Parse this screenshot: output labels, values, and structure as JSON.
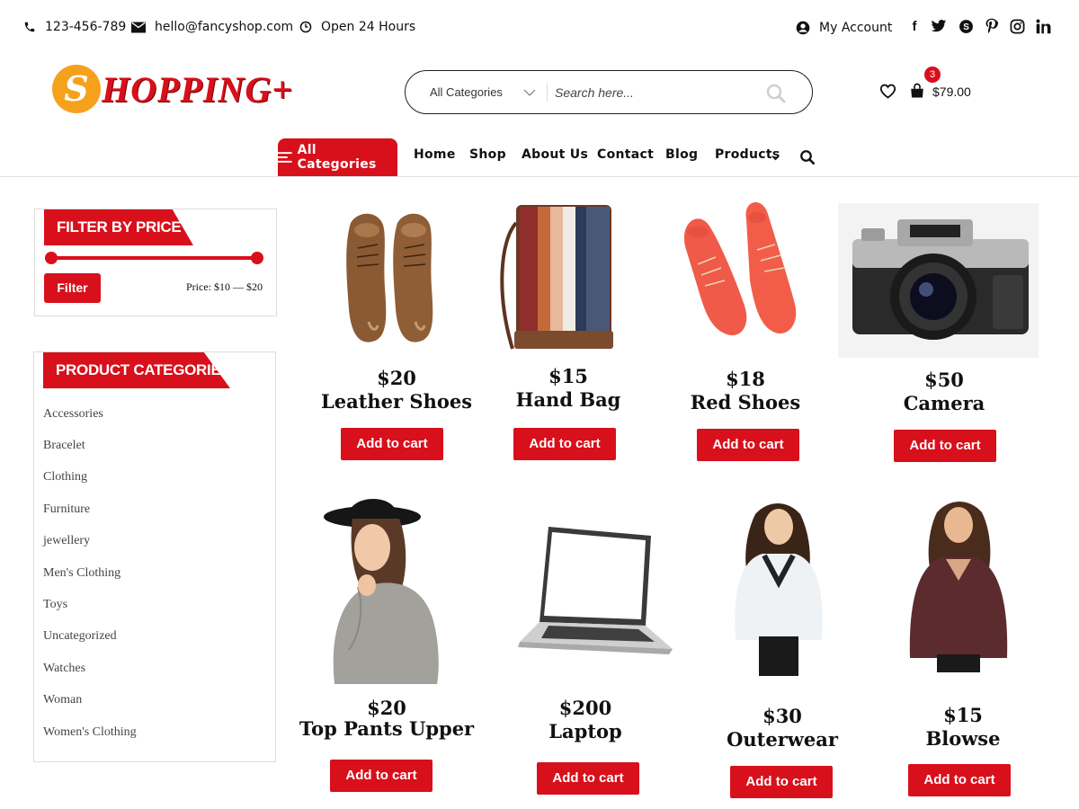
{
  "topbar": {
    "phone": "123-456-789",
    "email": "hello@fancyshop.com",
    "hours": "Open 24 Hours",
    "account": "My Account",
    "social": [
      "facebook-icon",
      "twitter-icon",
      "skype-icon",
      "pinterest-icon",
      "instagram-icon",
      "linkedin-icon"
    ]
  },
  "logo": {
    "initial": "S",
    "text": "HOPPING+"
  },
  "search": {
    "category": "All Categories",
    "placeholder": "Search here..."
  },
  "header": {
    "cart_count": "3",
    "cart_total": "$79.00"
  },
  "nav": {
    "all_categories": "All Categories",
    "items": [
      "Home",
      "Shop",
      "About Us",
      "Contact",
      "Blog",
      "Products"
    ]
  },
  "filter": {
    "title": "FILTER BY PRICE",
    "button": "Filter",
    "range": "Price: $10 — $20"
  },
  "categories": {
    "title": "PRODUCT CATEGORIES",
    "items": [
      "Accessories",
      "Bracelet",
      "Clothing",
      "Furniture",
      "jewellery",
      "Men's Clothing",
      "Toys",
      "Uncategorized",
      "Watches",
      "Woman",
      "Women's Clothing"
    ]
  },
  "products": [
    {
      "price": "$20",
      "name": "Leather Shoes",
      "button": "Add to cart"
    },
    {
      "price": "$15",
      "name": "Hand Bag",
      "button": "Add to cart"
    },
    {
      "price": "$18",
      "name": "Red Shoes",
      "button": "Add to cart"
    },
    {
      "price": "$50",
      "name": "Camera",
      "button": "Add to cart"
    },
    {
      "price": "$20",
      "name": "Top Pants Upper",
      "button": "Add to cart"
    },
    {
      "price": "$200",
      "name": "Laptop",
      "button": "Add to cart"
    },
    {
      "price": "$30",
      "name": "Outerwear",
      "button": "Add to cart"
    },
    {
      "price": "$15",
      "name": "Blowse",
      "button": "Add to cart"
    }
  ],
  "colors": {
    "accent": "#d8101b",
    "logo_orange": "#f6a11c"
  }
}
